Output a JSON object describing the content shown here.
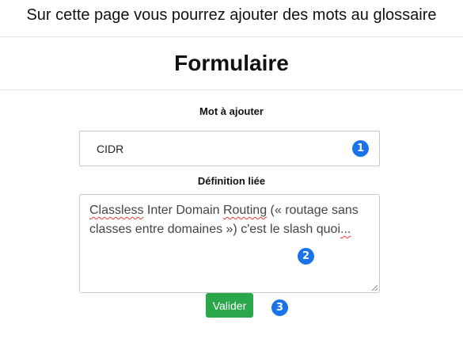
{
  "header": {
    "intro_text": "Sur cette page vous pourrez ajouter des mots au glossaire",
    "title": "Formulaire"
  },
  "form": {
    "word_label": "Mot à ajouter",
    "word_value": "CIDR",
    "definition_label": "Définition liée",
    "definition_value": "Classless Inter Domain Routing (« routage sans classes entre domaines ») c'est le slash quoi...",
    "submit_label": "Valider"
  },
  "annotations": {
    "marker_1": "1",
    "marker_2": "2",
    "marker_3": "3"
  },
  "colors": {
    "submit_button": "#2aa74a",
    "annotation_marker": "#1a73e8",
    "spellcheck_underline": "#e53935"
  }
}
